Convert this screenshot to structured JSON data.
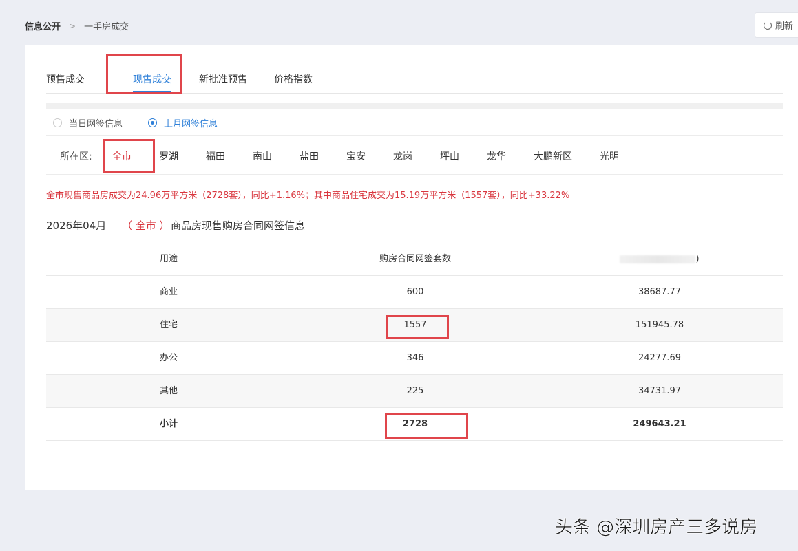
{
  "breadcrumb": {
    "root": "信息公开",
    "separator": ">",
    "current": "一手房成交"
  },
  "refresh_label": "刷新",
  "tabs": [
    {
      "label": "预售成交"
    },
    {
      "label": "现售成交"
    },
    {
      "label": "新批准预售"
    },
    {
      "label": "价格指数"
    }
  ],
  "active_tab": "现售成交",
  "radios": {
    "today_label": "当日网签信息",
    "last_month_label": "上月网签信息",
    "selected": "上月网签信息"
  },
  "district_label": "所在区:",
  "districts": [
    "全市",
    "罗湖",
    "福田",
    "南山",
    "盐田",
    "宝安",
    "龙岗",
    "坪山",
    "龙华",
    "大鹏新区",
    "光明"
  ],
  "selected_district": "全市",
  "summary": "全市现售商品房成交为24.96万平方米（2728套），同比+1.16%；其中商品住宅成交为15.19万平方米（1557套），同比+33.22%",
  "title": {
    "date": "2026年04月",
    "city": "（ 全市 ）",
    "desc": "商品房现售购房合同网签信息"
  },
  "table": {
    "headers": [
      "用途",
      "购房合同网签套数",
      ")"
    ],
    "rows": [
      [
        "商业",
        "600",
        "38687.77"
      ],
      [
        "住宅",
        "1557",
        "151945.78"
      ],
      [
        "办公",
        "346",
        "24277.69"
      ],
      [
        "其他",
        "225",
        "34731.97"
      ],
      [
        "小计",
        "2728",
        "249643.21"
      ]
    ]
  },
  "watermark": "头条 @深圳房产三多说房",
  "colors": {
    "accent_blue": "#2f80d8",
    "highlight_red": "#d9363e",
    "annotation_box": "#e0454b"
  }
}
